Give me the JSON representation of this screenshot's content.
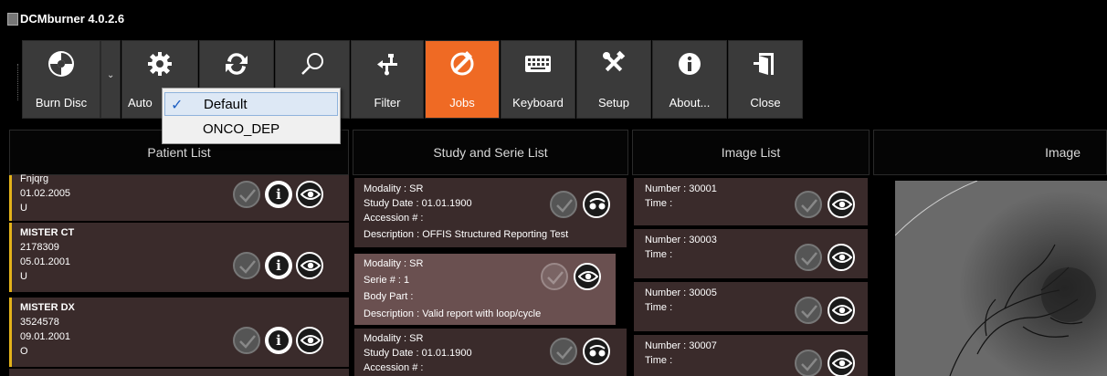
{
  "window": {
    "title": "DCMburner 4.0.2.6"
  },
  "toolbar": {
    "buttons": [
      {
        "label": "Burn Disc",
        "icon": "disc-icon"
      },
      {
        "label": "Auto",
        "icon": "gear-icon"
      },
      {
        "label": "",
        "icon": "refresh-icon"
      },
      {
        "label": "",
        "icon": "magnifier-icon"
      },
      {
        "label": "Filter",
        "icon": "usb-icon"
      },
      {
        "label": "Jobs",
        "icon": "jobs-icon"
      },
      {
        "label": "Keyboard",
        "icon": "keyboard-icon"
      },
      {
        "label": "Setup",
        "icon": "tools-icon"
      },
      {
        "label": "About...",
        "icon": "info-icon"
      },
      {
        "label": "Close",
        "icon": "exit-door-icon"
      }
    ],
    "active_color": "#ef6a24"
  },
  "dropdown": {
    "items": [
      {
        "label": "Default",
        "checked": true
      },
      {
        "label": "ONCO_DEP",
        "checked": false
      }
    ]
  },
  "columns": {
    "patient": "Patient List",
    "study": "Study and Serie List",
    "image_list": "Image List",
    "image": "Image"
  },
  "patients": [
    {
      "name": "Fnjqrg",
      "id": "",
      "dob": "01.02.2005",
      "sex": "U"
    },
    {
      "name": "MISTER CT",
      "id": "2178309",
      "dob": "05.01.2001",
      "sex": "U"
    },
    {
      "name": "MISTER DX",
      "id": "3524578",
      "dob": "09.01.2001",
      "sex": "O"
    }
  ],
  "studies": [
    {
      "lines": [
        "Modality : SR",
        "Study Date : 01.01.1900",
        "Accession # :",
        "Description : OFFIS Structured Reporting Test"
      ]
    },
    {
      "lines": [
        "Modality : SR",
        "Serie # : 1",
        "Body Part :",
        "Description : Valid report with loop/cycle"
      ]
    },
    {
      "lines": [
        "Modality : SR",
        "Study Date : 01.01.1900",
        "Accession # :"
      ]
    }
  ],
  "images": [
    {
      "number": "Number  : 30001",
      "time": "Time  :"
    },
    {
      "number": "Number  : 30003",
      "time": "Time  :"
    },
    {
      "number": "Number  : 30005",
      "time": "Time  :"
    },
    {
      "number": "Number  : 30007",
      "time": "Time  :"
    }
  ]
}
